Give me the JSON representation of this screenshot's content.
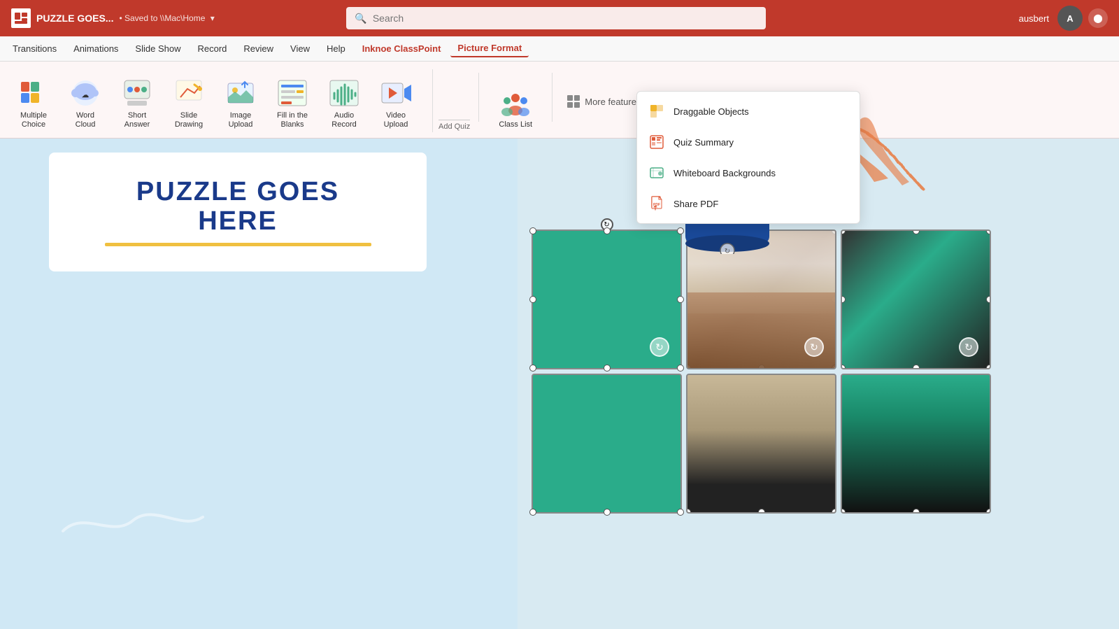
{
  "titleBar": {
    "docTitle": "PUZZLE GOES...",
    "saveStatus": "• Saved to \\\\Mac\\Home",
    "saveIcon": "▾",
    "searchPlaceholder": "Search",
    "username": "ausbert",
    "avatarInitial": "A"
  },
  "menuBar": {
    "items": [
      {
        "label": "Transitions",
        "active": false
      },
      {
        "label": "Animations",
        "active": false
      },
      {
        "label": "Slide Show",
        "active": false
      },
      {
        "label": "Record",
        "active": false
      },
      {
        "label": "Review",
        "active": false
      },
      {
        "label": "View",
        "active": false
      },
      {
        "label": "Help",
        "active": false
      },
      {
        "label": "Inknoe ClassPoint",
        "active": false,
        "classpoint": true
      },
      {
        "label": "Picture Format",
        "active": true
      }
    ]
  },
  "ribbon": {
    "quizItems": [
      {
        "label": "Multiple\nChoice",
        "icon": "📊"
      },
      {
        "label": "Word\nCloud",
        "icon": "💬"
      },
      {
        "label": "Short\nAnswer",
        "icon": "💭"
      },
      {
        "label": "Slide\nDrawing",
        "icon": "✏️"
      },
      {
        "label": "Image\nUpload",
        "icon": "🖼️"
      },
      {
        "label": "Fill in the\nBlanks",
        "icon": "📋"
      },
      {
        "label": "Audio\nRecord",
        "icon": "🎵"
      },
      {
        "label": "Video\nUpload",
        "icon": "🎬"
      }
    ],
    "addQuizLabel": "Add Quiz",
    "classListLabel": "Class List",
    "moreFeaturesLabel": "More features"
  },
  "dropdownMenu": {
    "items": [
      {
        "label": "Draggable Objects",
        "icon": "⭐",
        "iconColor": "#f0b429"
      },
      {
        "label": "Quiz Summary",
        "icon": "📌",
        "iconColor": "#e0443a"
      },
      {
        "label": "Whiteboard Backgrounds",
        "icon": "💬",
        "iconColor": "#4caf87"
      },
      {
        "label": "Share PDF",
        "icon": "📄",
        "iconColor": "#e0443a"
      }
    ]
  },
  "slide": {
    "puzzleTitle": "PUZZLE GOES\nHERE",
    "bgColor": "#d8eaf2"
  }
}
